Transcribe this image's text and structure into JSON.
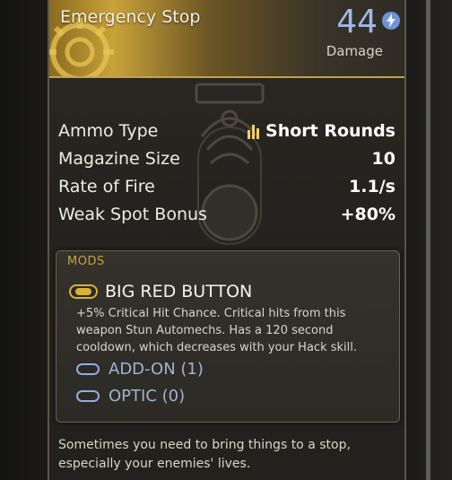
{
  "weapon": {
    "name": "Emergency Stop",
    "damage_value": "44",
    "damage_label": "Damage"
  },
  "stats": [
    {
      "label": "Ammo Type",
      "value": "Short Rounds"
    },
    {
      "label": "Magazine Size",
      "value": "10"
    },
    {
      "label": "Rate of Fire",
      "value": "1.1/s"
    },
    {
      "label": "Weak Spot Bonus",
      "value": "+80%"
    }
  ],
  "mods": {
    "heading": "MODS",
    "installed": {
      "name": "BIG RED BUTTON",
      "description": "+5% Critical Hit Chance. Critical hits from this weapon Stun Automechs. Has a 120 second cooldown, which decreases with your Hack skill."
    },
    "slots": [
      {
        "label": "ADD-ON (1)"
      },
      {
        "label": "OPTIC (0)"
      }
    ]
  },
  "flavor_text": "Sometimes you need to bring things to a stop, especially your enemies' lives.",
  "colors": {
    "accent_gold": "#c9a23a",
    "damage_blue": "#9fb8e8",
    "slot_blue": "#8fb0dc"
  },
  "icons": {
    "damage": "lightning-bolt-icon",
    "ammo": "ammo-bullets-icon",
    "mod_installed": "mod-chip-icon",
    "slot_empty": "empty-slot-icon"
  }
}
